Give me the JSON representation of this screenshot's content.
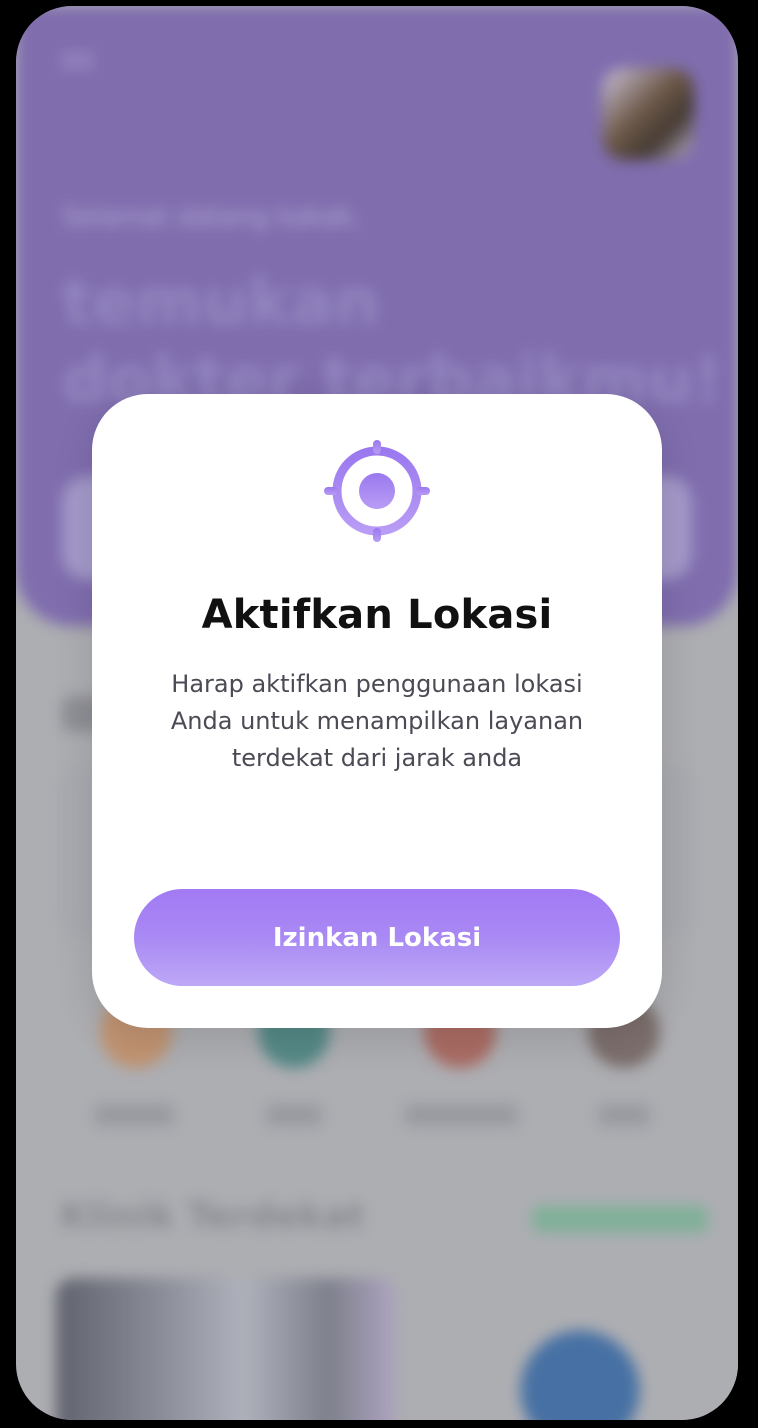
{
  "background": {
    "greeting": "Selamat datang kakak,",
    "headline_line1": "temukan",
    "headline_line2": "dokter terbaikmu!",
    "nearby_title": "Klinik Terdekat"
  },
  "modal": {
    "icon": "location-target-icon",
    "title": "Aktifkan Lokasi",
    "description": "Harap aktifkan penggunaan lokasi Anda untuk menampilkan layanan terdekat dari jarak anda",
    "button_label": "Izinkan Lokasi"
  },
  "colors": {
    "accent": "#A27AF4",
    "hero": "#7F6AB3"
  }
}
